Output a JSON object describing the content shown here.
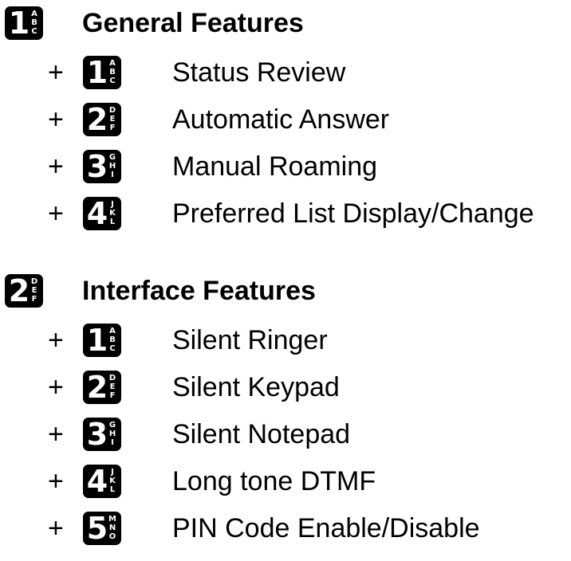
{
  "colors": {
    "background": "#ffffff",
    "text": "#000000",
    "key_fill": "#000000",
    "key_text": "#ffffff"
  },
  "plus_sign": "+",
  "sections": [
    {
      "key": {
        "digit": "1",
        "letters": [
          "A",
          "B",
          "C"
        ],
        "icon": "keypad-1-key-icon"
      },
      "title": "General Features",
      "items": [
        {
          "key": {
            "digit": "1",
            "letters": [
              "A",
              "B",
              "C"
            ],
            "icon": "keypad-1-key-icon"
          },
          "label": "Status Review"
        },
        {
          "key": {
            "digit": "2",
            "letters": [
              "D",
              "E",
              "F"
            ],
            "icon": "keypad-2-key-icon"
          },
          "label": "Automatic Answer"
        },
        {
          "key": {
            "digit": "3",
            "letters": [
              "G",
              "H",
              "I"
            ],
            "icon": "keypad-3-key-icon"
          },
          "label": "Manual Roaming"
        },
        {
          "key": {
            "digit": "4",
            "letters": [
              "J",
              "K",
              "L"
            ],
            "icon": "keypad-4-key-icon"
          },
          "label": "Preferred List Display/Change"
        }
      ]
    },
    {
      "key": {
        "digit": "2",
        "letters": [
          "D",
          "E",
          "F"
        ],
        "icon": "keypad-2-key-icon"
      },
      "title": "Interface Features",
      "items": [
        {
          "key": {
            "digit": "1",
            "letters": [
              "A",
              "B",
              "C"
            ],
            "icon": "keypad-1-key-icon"
          },
          "label": "Silent Ringer"
        },
        {
          "key": {
            "digit": "2",
            "letters": [
              "D",
              "E",
              "F"
            ],
            "icon": "keypad-2-key-icon"
          },
          "label": "Silent Keypad"
        },
        {
          "key": {
            "digit": "3",
            "letters": [
              "G",
              "H",
              "I"
            ],
            "icon": "keypad-3-key-icon"
          },
          "label": "Silent Notepad"
        },
        {
          "key": {
            "digit": "4",
            "letters": [
              "J",
              "K",
              "L"
            ],
            "icon": "keypad-4-key-icon"
          },
          "label": "Long tone DTMF"
        },
        {
          "key": {
            "digit": "5",
            "letters": [
              "M",
              "N",
              "O"
            ],
            "icon": "keypad-5-key-icon"
          },
          "label": "PIN Code Enable/Disable"
        }
      ]
    }
  ]
}
